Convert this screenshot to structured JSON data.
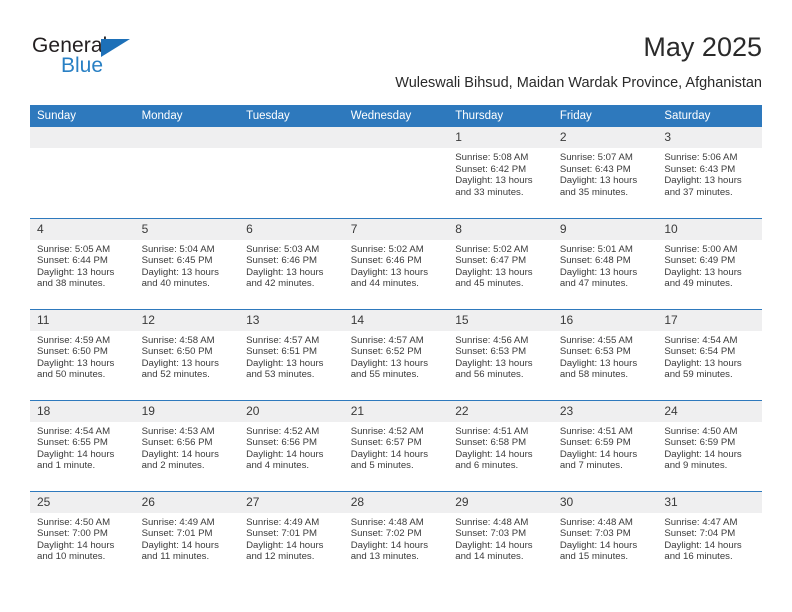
{
  "logo": {
    "word_one": "General",
    "word_two": "Blue",
    "triangle_icon": "blue-triangle-icon",
    "accent_dark": "#231f20",
    "accent_blue": "#2980c4"
  },
  "header": {
    "title": "May 2025",
    "subtitle": "Wuleswali Bihsud, Maidan Wardak Province, Afghanistan"
  },
  "colors": {
    "header_bg": "#2e79bd",
    "daynum_bg": "#efeff0",
    "text": "#3b3b3b"
  },
  "weekdays": [
    "Sunday",
    "Monday",
    "Tuesday",
    "Wednesday",
    "Thursday",
    "Friday",
    "Saturday"
  ],
  "weeks": [
    [
      {
        "day": "",
        "empty": true
      },
      {
        "day": "",
        "empty": true
      },
      {
        "day": "",
        "empty": true
      },
      {
        "day": "",
        "empty": true
      },
      {
        "day": "1",
        "sunrise": "Sunrise: 5:08 AM",
        "sunset": "Sunset: 6:42 PM",
        "daylight1": "Daylight: 13 hours",
        "daylight2": "and 33 minutes."
      },
      {
        "day": "2",
        "sunrise": "Sunrise: 5:07 AM",
        "sunset": "Sunset: 6:43 PM",
        "daylight1": "Daylight: 13 hours",
        "daylight2": "and 35 minutes."
      },
      {
        "day": "3",
        "sunrise": "Sunrise: 5:06 AM",
        "sunset": "Sunset: 6:43 PM",
        "daylight1": "Daylight: 13 hours",
        "daylight2": "and 37 minutes."
      }
    ],
    [
      {
        "day": "4",
        "sunrise": "Sunrise: 5:05 AM",
        "sunset": "Sunset: 6:44 PM",
        "daylight1": "Daylight: 13 hours",
        "daylight2": "and 38 minutes."
      },
      {
        "day": "5",
        "sunrise": "Sunrise: 5:04 AM",
        "sunset": "Sunset: 6:45 PM",
        "daylight1": "Daylight: 13 hours",
        "daylight2": "and 40 minutes."
      },
      {
        "day": "6",
        "sunrise": "Sunrise: 5:03 AM",
        "sunset": "Sunset: 6:46 PM",
        "daylight1": "Daylight: 13 hours",
        "daylight2": "and 42 minutes."
      },
      {
        "day": "7",
        "sunrise": "Sunrise: 5:02 AM",
        "sunset": "Sunset: 6:46 PM",
        "daylight1": "Daylight: 13 hours",
        "daylight2": "and 44 minutes."
      },
      {
        "day": "8",
        "sunrise": "Sunrise: 5:02 AM",
        "sunset": "Sunset: 6:47 PM",
        "daylight1": "Daylight: 13 hours",
        "daylight2": "and 45 minutes."
      },
      {
        "day": "9",
        "sunrise": "Sunrise: 5:01 AM",
        "sunset": "Sunset: 6:48 PM",
        "daylight1": "Daylight: 13 hours",
        "daylight2": "and 47 minutes."
      },
      {
        "day": "10",
        "sunrise": "Sunrise: 5:00 AM",
        "sunset": "Sunset: 6:49 PM",
        "daylight1": "Daylight: 13 hours",
        "daylight2": "and 49 minutes."
      }
    ],
    [
      {
        "day": "11",
        "sunrise": "Sunrise: 4:59 AM",
        "sunset": "Sunset: 6:50 PM",
        "daylight1": "Daylight: 13 hours",
        "daylight2": "and 50 minutes."
      },
      {
        "day": "12",
        "sunrise": "Sunrise: 4:58 AM",
        "sunset": "Sunset: 6:50 PM",
        "daylight1": "Daylight: 13 hours",
        "daylight2": "and 52 minutes."
      },
      {
        "day": "13",
        "sunrise": "Sunrise: 4:57 AM",
        "sunset": "Sunset: 6:51 PM",
        "daylight1": "Daylight: 13 hours",
        "daylight2": "and 53 minutes."
      },
      {
        "day": "14",
        "sunrise": "Sunrise: 4:57 AM",
        "sunset": "Sunset: 6:52 PM",
        "daylight1": "Daylight: 13 hours",
        "daylight2": "and 55 minutes."
      },
      {
        "day": "15",
        "sunrise": "Sunrise: 4:56 AM",
        "sunset": "Sunset: 6:53 PM",
        "daylight1": "Daylight: 13 hours",
        "daylight2": "and 56 minutes."
      },
      {
        "day": "16",
        "sunrise": "Sunrise: 4:55 AM",
        "sunset": "Sunset: 6:53 PM",
        "daylight1": "Daylight: 13 hours",
        "daylight2": "and 58 minutes."
      },
      {
        "day": "17",
        "sunrise": "Sunrise: 4:54 AM",
        "sunset": "Sunset: 6:54 PM",
        "daylight1": "Daylight: 13 hours",
        "daylight2": "and 59 minutes."
      }
    ],
    [
      {
        "day": "18",
        "sunrise": "Sunrise: 4:54 AM",
        "sunset": "Sunset: 6:55 PM",
        "daylight1": "Daylight: 14 hours",
        "daylight2": "and 1 minute."
      },
      {
        "day": "19",
        "sunrise": "Sunrise: 4:53 AM",
        "sunset": "Sunset: 6:56 PM",
        "daylight1": "Daylight: 14 hours",
        "daylight2": "and 2 minutes."
      },
      {
        "day": "20",
        "sunrise": "Sunrise: 4:52 AM",
        "sunset": "Sunset: 6:56 PM",
        "daylight1": "Daylight: 14 hours",
        "daylight2": "and 4 minutes."
      },
      {
        "day": "21",
        "sunrise": "Sunrise: 4:52 AM",
        "sunset": "Sunset: 6:57 PM",
        "daylight1": "Daylight: 14 hours",
        "daylight2": "and 5 minutes."
      },
      {
        "day": "22",
        "sunrise": "Sunrise: 4:51 AM",
        "sunset": "Sunset: 6:58 PM",
        "daylight1": "Daylight: 14 hours",
        "daylight2": "and 6 minutes."
      },
      {
        "day": "23",
        "sunrise": "Sunrise: 4:51 AM",
        "sunset": "Sunset: 6:59 PM",
        "daylight1": "Daylight: 14 hours",
        "daylight2": "and 7 minutes."
      },
      {
        "day": "24",
        "sunrise": "Sunrise: 4:50 AM",
        "sunset": "Sunset: 6:59 PM",
        "daylight1": "Daylight: 14 hours",
        "daylight2": "and 9 minutes."
      }
    ],
    [
      {
        "day": "25",
        "sunrise": "Sunrise: 4:50 AM",
        "sunset": "Sunset: 7:00 PM",
        "daylight1": "Daylight: 14 hours",
        "daylight2": "and 10 minutes."
      },
      {
        "day": "26",
        "sunrise": "Sunrise: 4:49 AM",
        "sunset": "Sunset: 7:01 PM",
        "daylight1": "Daylight: 14 hours",
        "daylight2": "and 11 minutes."
      },
      {
        "day": "27",
        "sunrise": "Sunrise: 4:49 AM",
        "sunset": "Sunset: 7:01 PM",
        "daylight1": "Daylight: 14 hours",
        "daylight2": "and 12 minutes."
      },
      {
        "day": "28",
        "sunrise": "Sunrise: 4:48 AM",
        "sunset": "Sunset: 7:02 PM",
        "daylight1": "Daylight: 14 hours",
        "daylight2": "and 13 minutes."
      },
      {
        "day": "29",
        "sunrise": "Sunrise: 4:48 AM",
        "sunset": "Sunset: 7:03 PM",
        "daylight1": "Daylight: 14 hours",
        "daylight2": "and 14 minutes."
      },
      {
        "day": "30",
        "sunrise": "Sunrise: 4:48 AM",
        "sunset": "Sunset: 7:03 PM",
        "daylight1": "Daylight: 14 hours",
        "daylight2": "and 15 minutes."
      },
      {
        "day": "31",
        "sunrise": "Sunrise: 4:47 AM",
        "sunset": "Sunset: 7:04 PM",
        "daylight1": "Daylight: 14 hours",
        "daylight2": "and 16 minutes."
      }
    ]
  ]
}
